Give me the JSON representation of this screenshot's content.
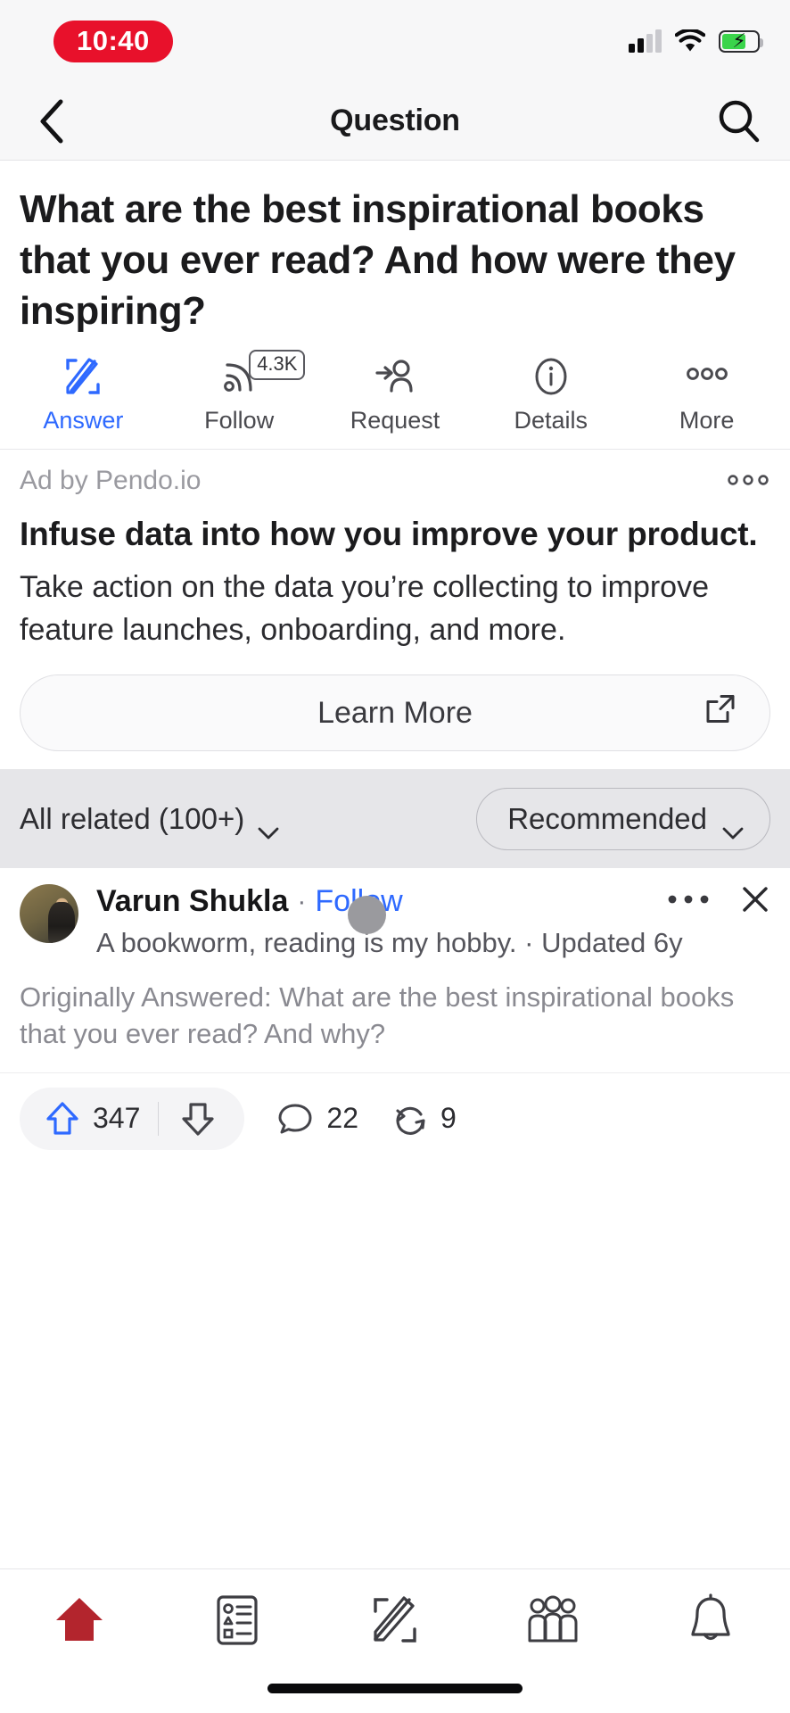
{
  "status_bar": {
    "time": "10:40",
    "icons": [
      "signal-bars-icon",
      "wifi-icon",
      "battery-charging-icon"
    ]
  },
  "nav": {
    "back_icon": "chevron-left-icon",
    "title": "Question",
    "search_icon": "search-icon"
  },
  "question": {
    "title": "What are the best inspirational books that you ever read? And how were they inspiring?",
    "actions": [
      {
        "label": "Answer",
        "icon": "write-pencil-icon",
        "badge": "",
        "primary": true
      },
      {
        "label": "Follow",
        "icon": "follow-rss-icon",
        "badge": "4.3K",
        "primary": false
      },
      {
        "label": "Request",
        "icon": "request-person-arrow-icon",
        "badge": "",
        "primary": false
      },
      {
        "label": "Details",
        "icon": "info-circle-icon",
        "badge": "",
        "primary": false
      },
      {
        "label": "More",
        "icon": "more-dots-icon",
        "badge": "",
        "primary": false
      }
    ]
  },
  "ad": {
    "sponsor": "Ad by Pendo.io",
    "menu_icon": "more-dots-icon",
    "headline": "Infuse data into how you improve your product.",
    "body": "Take action on the data you’re collecting to improve feature launches, onboarding, and more.",
    "cta_label": "Learn More",
    "cta_icon": "external-link-icon"
  },
  "filters": {
    "related_label": "All related (100+)",
    "related_icon": "chevron-down-icon",
    "sort_label": "Recommended",
    "sort_icon": "chevron-down-icon"
  },
  "answer": {
    "avatar": "user-avatar",
    "author_name": "Varun Shukla",
    "separator": "·",
    "follow_label": "Follow",
    "more_icon": "more-dots-icon",
    "close_icon": "close-x-icon",
    "bio": "A bookworm, reading is my hobby. · Updated 6y",
    "originally_answered": "Originally Answered: What are the best inspirational books that you ever read? And why?",
    "engagement": {
      "upvote_icon": "upvote-arrow-icon",
      "upvote_count": "347",
      "downvote_icon": "downvote-arrow-icon",
      "comment_icon": "comment-bubble-icon",
      "comment_count": "22",
      "share_icon": "repost-share-icon",
      "share_count": "9"
    }
  },
  "tab_bar": {
    "tabs": [
      {
        "name": "home",
        "icon": "home-icon",
        "active": true
      },
      {
        "name": "following",
        "icon": "feed-list-icon",
        "active": false
      },
      {
        "name": "answer",
        "icon": "write-pencil-icon",
        "active": false
      },
      {
        "name": "spaces",
        "icon": "spaces-people-icon",
        "active": false
      },
      {
        "name": "notifications",
        "icon": "bell-icon",
        "active": false
      }
    ]
  },
  "colors": {
    "accent_blue": "#2e69ff",
    "brand_red": "#b3252d",
    "record_red": "#e8112b",
    "muted_gray": "#8a8a91"
  }
}
